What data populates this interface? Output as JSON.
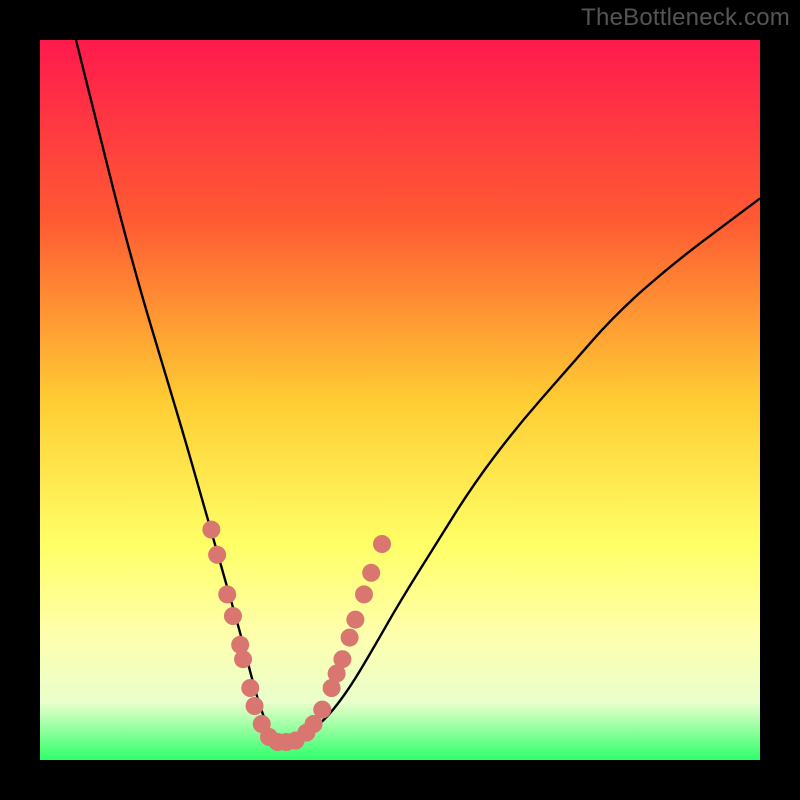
{
  "watermark": "TheBottleneck.com",
  "chart_data": {
    "type": "line",
    "title": "",
    "xlabel": "",
    "ylabel": "",
    "xlim": [
      0,
      100
    ],
    "ylim": [
      0,
      100
    ],
    "background_gradient": {
      "stops": [
        {
          "offset": 0,
          "color": "#ff1a4d"
        },
        {
          "offset": 25,
          "color": "#ff5a33"
        },
        {
          "offset": 50,
          "color": "#ffcc33"
        },
        {
          "offset": 70,
          "color": "#ffff66"
        },
        {
          "offset": 82,
          "color": "#ffffaa"
        },
        {
          "offset": 92,
          "color": "#eaffcc"
        },
        {
          "offset": 100,
          "color": "#2fff6b"
        }
      ]
    },
    "series": [
      {
        "name": "bottleneck-curve",
        "x": [
          5,
          8,
          11,
          14,
          17,
          20,
          22,
          24,
          26,
          28,
          29.5,
          31,
          32.5,
          34.5,
          37,
          40,
          43,
          46,
          50,
          55,
          60,
          66,
          73,
          80,
          88,
          96,
          100
        ],
        "y": [
          100,
          88,
          76,
          65,
          55,
          45,
          38,
          31,
          24,
          17,
          11,
          6,
          3,
          2.5,
          3.5,
          6,
          10,
          15,
          22,
          30,
          38,
          46,
          54,
          62,
          69,
          75,
          78
        ]
      }
    ],
    "markers": {
      "name": "sample-points",
      "color": "#d9766f",
      "radius": 9,
      "points": [
        {
          "x": 23.8,
          "y": 32
        },
        {
          "x": 24.6,
          "y": 28.5
        },
        {
          "x": 26.0,
          "y": 23
        },
        {
          "x": 26.8,
          "y": 20
        },
        {
          "x": 27.8,
          "y": 16
        },
        {
          "x": 28.2,
          "y": 14
        },
        {
          "x": 29.2,
          "y": 10
        },
        {
          "x": 29.8,
          "y": 7.5
        },
        {
          "x": 30.8,
          "y": 5
        },
        {
          "x": 31.8,
          "y": 3.2
        },
        {
          "x": 33.0,
          "y": 2.5
        },
        {
          "x": 34.2,
          "y": 2.5
        },
        {
          "x": 35.5,
          "y": 2.7
        },
        {
          "x": 37.0,
          "y": 3.8
        },
        {
          "x": 38.0,
          "y": 5
        },
        {
          "x": 39.2,
          "y": 7
        },
        {
          "x": 40.5,
          "y": 10
        },
        {
          "x": 41.2,
          "y": 12
        },
        {
          "x": 42.0,
          "y": 14
        },
        {
          "x": 43.0,
          "y": 17
        },
        {
          "x": 43.8,
          "y": 19.5
        },
        {
          "x": 45.0,
          "y": 23
        },
        {
          "x": 46.0,
          "y": 26
        },
        {
          "x": 47.5,
          "y": 30
        }
      ]
    }
  }
}
